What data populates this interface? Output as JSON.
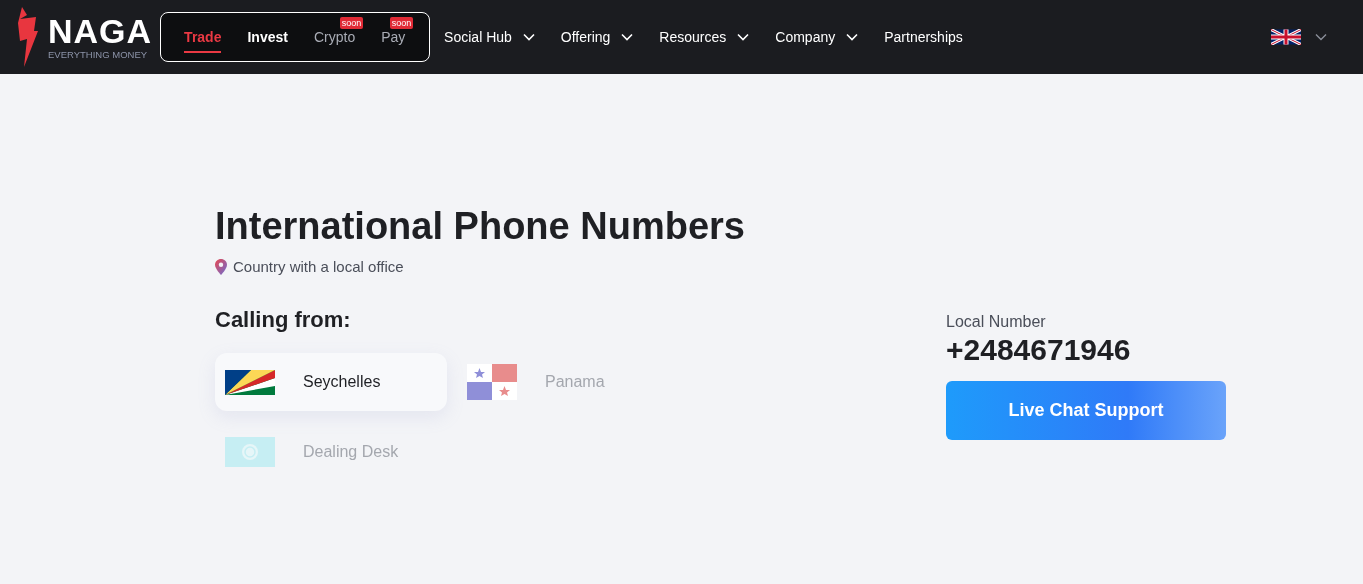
{
  "brand": {
    "name": "NAGA",
    "tagline": "EVERYTHING MONEY"
  },
  "product_tabs": [
    {
      "label": "Trade",
      "selected": true
    },
    {
      "label": "Invest",
      "selected": false
    },
    {
      "label": "Crypto",
      "selected": false,
      "badge": "soon"
    },
    {
      "label": "Pay",
      "selected": false,
      "badge": "soon"
    }
  ],
  "nav": [
    {
      "label": "Social Hub",
      "has_menu": true
    },
    {
      "label": "Offering",
      "has_menu": true
    },
    {
      "label": "Resources",
      "has_menu": true
    },
    {
      "label": "Company",
      "has_menu": true
    },
    {
      "label": "Partnerships",
      "has_menu": false
    }
  ],
  "heading": "International Phone Numbers",
  "legend": "Country with a local office",
  "calling_from": {
    "label": "Calling from:",
    "options": [
      {
        "name": "Seychelles",
        "kind": "seychelles",
        "selected": true
      },
      {
        "name": "Panama",
        "kind": "panama",
        "selected": false
      },
      {
        "name": "Dealing Desk",
        "kind": "desk",
        "selected": false
      }
    ]
  },
  "contact": {
    "label": "Local Number",
    "number": "+2484671946",
    "button": "Live Chat Support"
  }
}
